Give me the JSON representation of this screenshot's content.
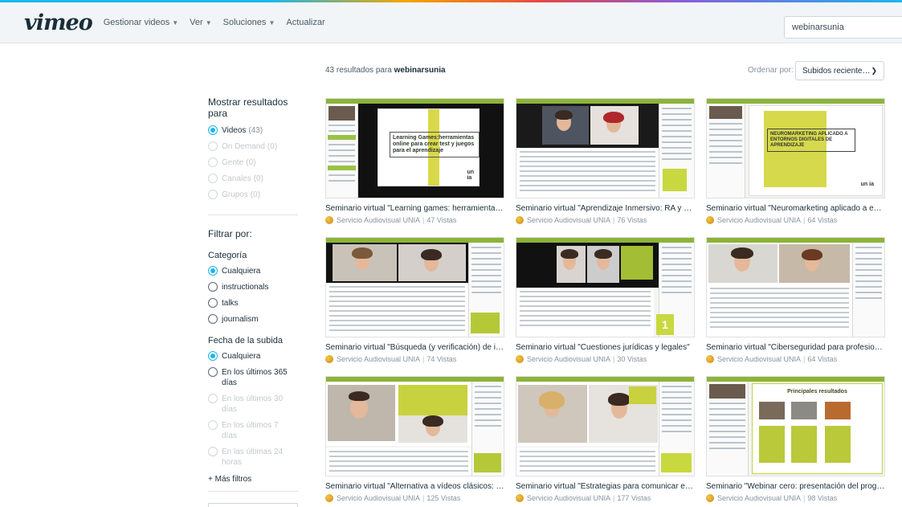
{
  "header": {
    "logo": "vimeo",
    "nav": [
      {
        "label": "Gestionar videos",
        "has_dropdown": true
      },
      {
        "label": "Ver",
        "has_dropdown": true
      },
      {
        "label": "Soluciones",
        "has_dropdown": true
      },
      {
        "label": "Actualizar",
        "has_dropdown": false
      }
    ],
    "search_value": "webinarsunia"
  },
  "results": {
    "count_text": "43 resultados para",
    "query": "webinarsunia",
    "sort_label": "Ordenar por:",
    "sort_value": "Subidos reciente…"
  },
  "sidebar": {
    "show_results_title": "Mostrar resultados para",
    "show_options": [
      {
        "label": "Videos",
        "count": "(43)",
        "checked": true,
        "enabled": true
      },
      {
        "label": "On Demand",
        "count": "(0)",
        "checked": false,
        "enabled": false
      },
      {
        "label": "Gente",
        "count": "(0)",
        "checked": false,
        "enabled": false
      },
      {
        "label": "Canales",
        "count": "(0)",
        "checked": false,
        "enabled": false
      },
      {
        "label": "Grupos",
        "count": "(0)",
        "checked": false,
        "enabled": false
      }
    ],
    "filter_title": "Filtrar por:",
    "category_title": "Categoría",
    "category_options": [
      {
        "label": "Cualquiera",
        "checked": true
      },
      {
        "label": "instructionals",
        "checked": false
      },
      {
        "label": "talks",
        "checked": false
      },
      {
        "label": "journalism",
        "checked": false
      }
    ],
    "date_title": "Fecha de la subida",
    "date_options": [
      {
        "label": "Cualquiera",
        "checked": true,
        "enabled": true
      },
      {
        "label": "En los últimos 365 días",
        "checked": false,
        "enabled": true
      },
      {
        "label": "En los últimos 30 días",
        "checked": false,
        "enabled": false
      },
      {
        "label": "En los últimos 7 días",
        "checked": false,
        "enabled": false
      },
      {
        "label": "En las últimas 24 horas",
        "checked": false,
        "enabled": false
      }
    ],
    "more_filters": "+ Más filtros"
  },
  "videos": [
    {
      "title": "Seminario virtual \"Learning games: herramientas online para crear test y juegos para el aprendizaje\"",
      "author": "Servicio Audiovisual UNIA",
      "views": "47 Vistas",
      "thumb": "slide-learning",
      "slide_text": "Learning Games:herramientas online para crear test y juegos para el aprendizaje"
    },
    {
      "title": "Seminario virtual \"Aprendizaje Inmersivo: RA y RV\"",
      "author": "Servicio Audiovisual UNIA",
      "views": "76 Vistas",
      "thumb": "webcams-2",
      "slide_text": ""
    },
    {
      "title": "Seminario virtual \"Neuromarketing aplicado a entornos digitales de aprendizaje\"",
      "author": "Servicio Audiovisual UNIA",
      "views": "64 Vistas",
      "thumb": "slide-neuro",
      "slide_text": "NEUROMARKETING APLICADO A ENTORNOS DIGITALES DE APRENDIZAJE"
    },
    {
      "title": "Seminario virtual \"Búsqueda (y verificación) de información\"",
      "author": "Servicio Audiovisual UNIA",
      "views": "74 Vistas",
      "thumb": "webcams-2",
      "slide_text": ""
    },
    {
      "title": "Seminario virtual \"Cuestiones jurídicas y legales\"",
      "author": "Servicio Audiovisual UNIA",
      "views": "30 Vistas",
      "thumb": "webcams-2",
      "slide_text": ""
    },
    {
      "title": "Seminario virtual \"Ciberseguridad para profesionales\"",
      "author": "Servicio Audiovisual UNIA",
      "views": "64 Vistas",
      "thumb": "webcams-2",
      "slide_text": ""
    },
    {
      "title": "Seminario virtual \"Alternativa a vídeos clásicos: nuevos formatos\"",
      "author": "Servicio Audiovisual UNIA",
      "views": "125 Vistas",
      "thumb": "webcams-2",
      "slide_text": ""
    },
    {
      "title": "Seminario virtual \"Estrategias para comunicar en red\"",
      "author": "Servicio Audiovisual UNIA",
      "views": "177 Vistas",
      "thumb": "webcams-2",
      "slide_text": ""
    },
    {
      "title": "Seminario \"Webinar cero: presentación del programa\"",
      "author": "Servicio Audiovisual UNIA",
      "views": "98 Vistas",
      "thumb": "slide-results",
      "slide_text": "Principales resultados"
    }
  ],
  "colors": {
    "accent": "#1ab7ea",
    "brand_dark": "#1a2e3b",
    "slide_green": "#8cb33a"
  }
}
